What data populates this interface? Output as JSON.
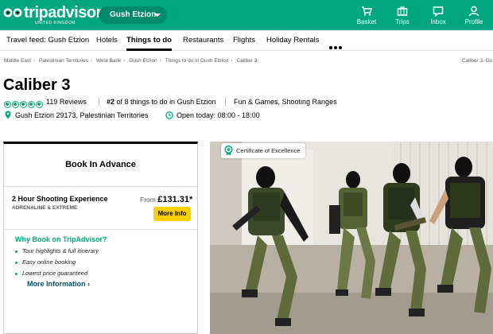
{
  "header": {
    "logo_text": "tripadvisor",
    "logo_subtext": "UNITED KINGDOM",
    "geo_button": "Gush Etzion",
    "nav": [
      {
        "label": "Basket",
        "icon": "basket-icon"
      },
      {
        "label": "Trips",
        "icon": "suitcase-icon"
      },
      {
        "label": "Inbox",
        "icon": "inbox-icon"
      },
      {
        "label": "Profile",
        "icon": "profile-icon"
      }
    ],
    "color": "#00a680"
  },
  "tabs": [
    {
      "label": "Travel feed: Gush Etzion",
      "active": false
    },
    {
      "label": "Hotels",
      "active": false
    },
    {
      "label": "Things to do",
      "active": true
    },
    {
      "label": "Restaurants",
      "active": false
    },
    {
      "label": "Flights",
      "active": false
    },
    {
      "label": "Holiday Rentals",
      "active": false
    }
  ],
  "breadcrumb": [
    "Middle East",
    "Palestinian Territories",
    "West Bank",
    "Gush Etzion",
    "Things to do in Gush Etzion",
    "Caliber 3"
  ],
  "breadcrumb_right": "Caliber 3, Gu",
  "attraction": {
    "title": "Caliber 3",
    "rating_bubbles": 5,
    "reviews": "119 Reviews",
    "rank_number": "#2",
    "rank_text": " of 8 things to do in Gush Etzion",
    "categories": "Fun & Games, Shooting Ranges",
    "address": "Gush Etzion 29173, Palestinian Territories",
    "hours": "Open today: 08:00 - 18:00"
  },
  "booking": {
    "heading": "Book In Advance",
    "product_title": "2 Hour Shooting Experience",
    "product_subtitle": "ADRENALINE & EXTREME",
    "from_label": "From ",
    "price": "£131.31*",
    "more_info_label": "More Info",
    "why_title": "Why Book on TripAdvisor?",
    "why_items": [
      "Tour highlights & full itinerary",
      "Easy online booking",
      "Lowest price guaranteed"
    ],
    "more_link": "More Information ›",
    "button_color": "#fcd000"
  },
  "photo": {
    "certificate": "Certificate of Excellence"
  }
}
